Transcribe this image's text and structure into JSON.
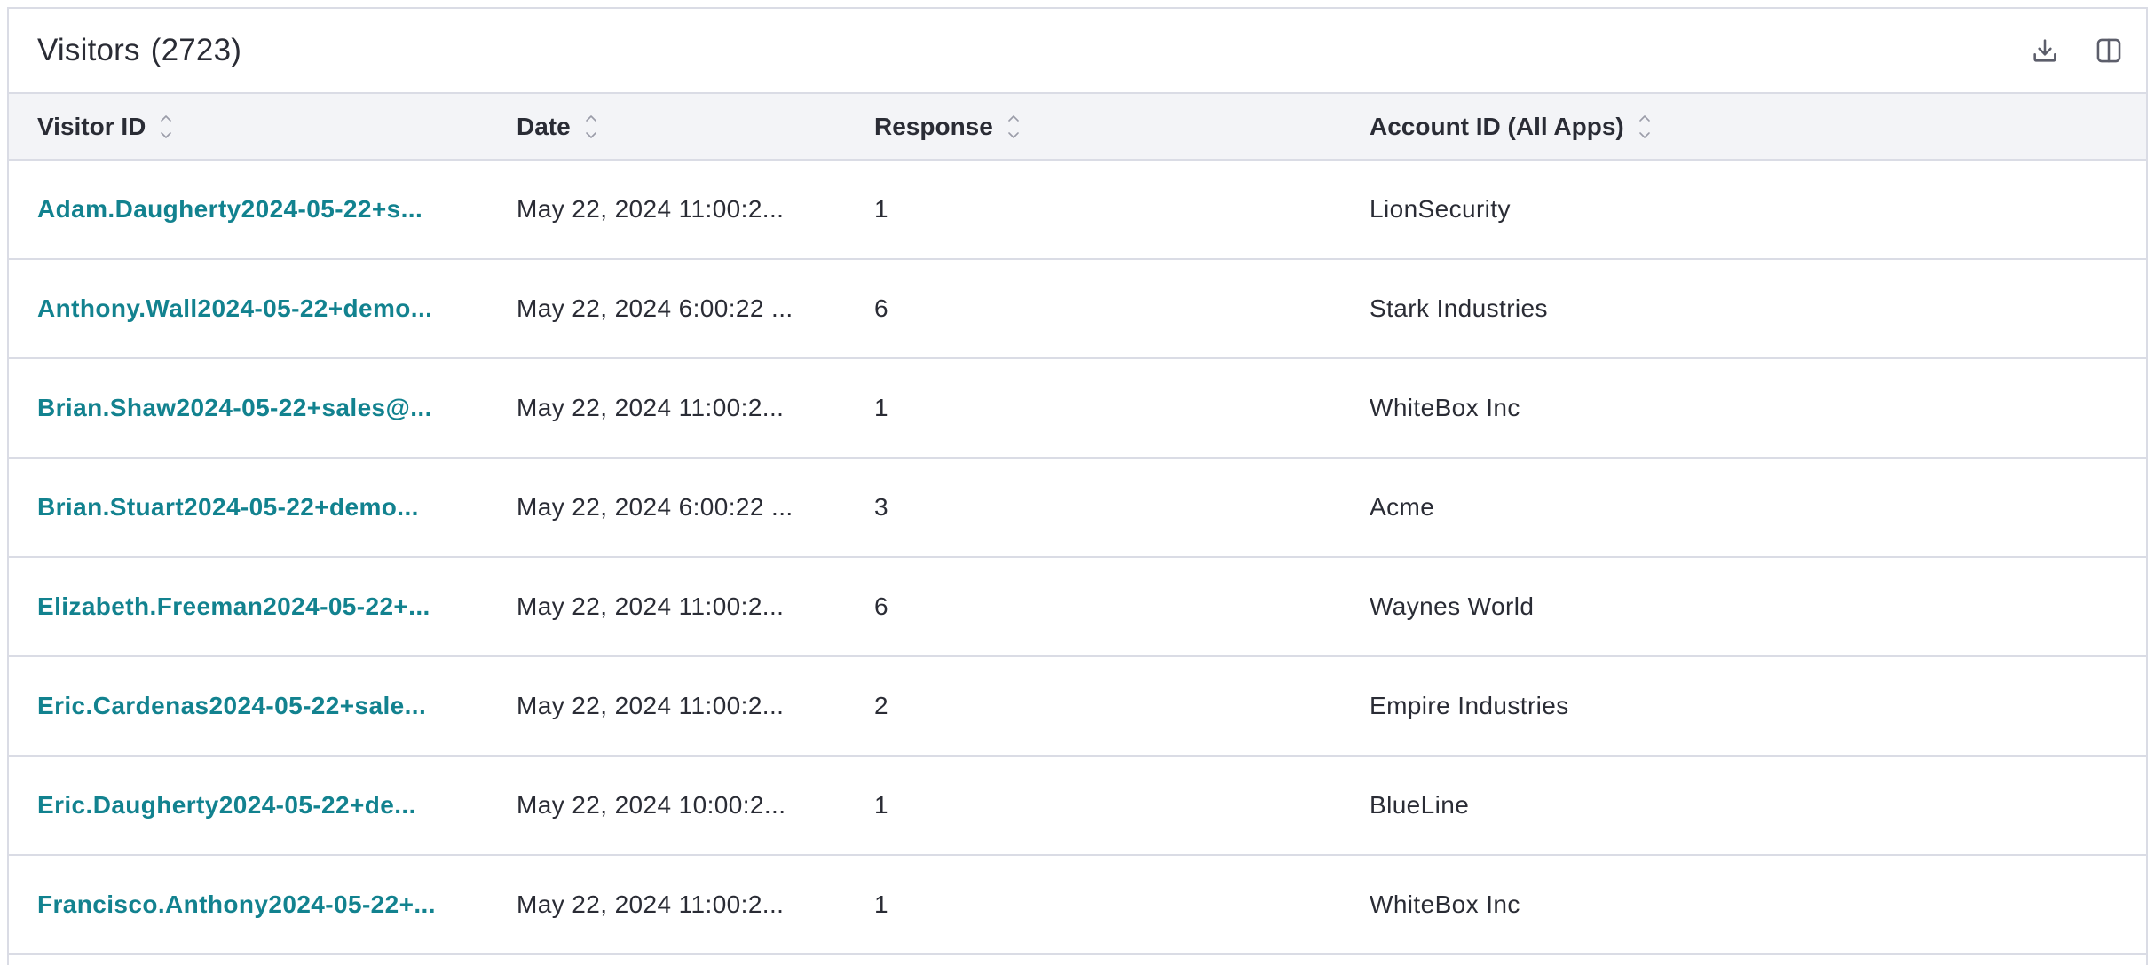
{
  "panel": {
    "title": "Visitors",
    "count": "(2723)",
    "download_icon": "download-icon",
    "columns_icon": "columns-icon"
  },
  "table": {
    "columns": [
      "Visitor ID",
      "Date",
      "Response",
      "Account ID (All Apps)"
    ],
    "rows": [
      {
        "visitor": "Adam.Daugherty2024-05-22+s...",
        "date": "May 22, 2024 11:00:2...",
        "response": "1",
        "account": "LionSecurity"
      },
      {
        "visitor": "Anthony.Wall2024-05-22+demo...",
        "date": "May 22, 2024 6:00:22 ...",
        "response": "6",
        "account": "Stark Industries"
      },
      {
        "visitor": "Brian.Shaw2024-05-22+sales@...",
        "date": "May 22, 2024 11:00:2...",
        "response": "1",
        "account": "WhiteBox Inc"
      },
      {
        "visitor": "Brian.Stuart2024-05-22+demo...",
        "date": "May 22, 2024 6:00:22 ...",
        "response": "3",
        "account": "Acme"
      },
      {
        "visitor": "Elizabeth.Freeman2024-05-22+...",
        "date": "May 22, 2024 11:00:2...",
        "response": "6",
        "account": "Waynes World"
      },
      {
        "visitor": "Eric.Cardenas2024-05-22+sale...",
        "date": "May 22, 2024 11:00:2...",
        "response": "2",
        "account": "Empire Industries"
      },
      {
        "visitor": "Eric.Daugherty2024-05-22+de...",
        "date": "May 22, 2024 10:00:2...",
        "response": "1",
        "account": "BlueLine"
      },
      {
        "visitor": "Francisco.Anthony2024-05-22+...",
        "date": "May 22, 2024 11:00:2...",
        "response": "1",
        "account": "WhiteBox Inc"
      }
    ]
  },
  "colors": {
    "link": "#12828f",
    "header_bg": "#f3f4f7",
    "border": "#dadce5",
    "text": "#2a2c35"
  }
}
